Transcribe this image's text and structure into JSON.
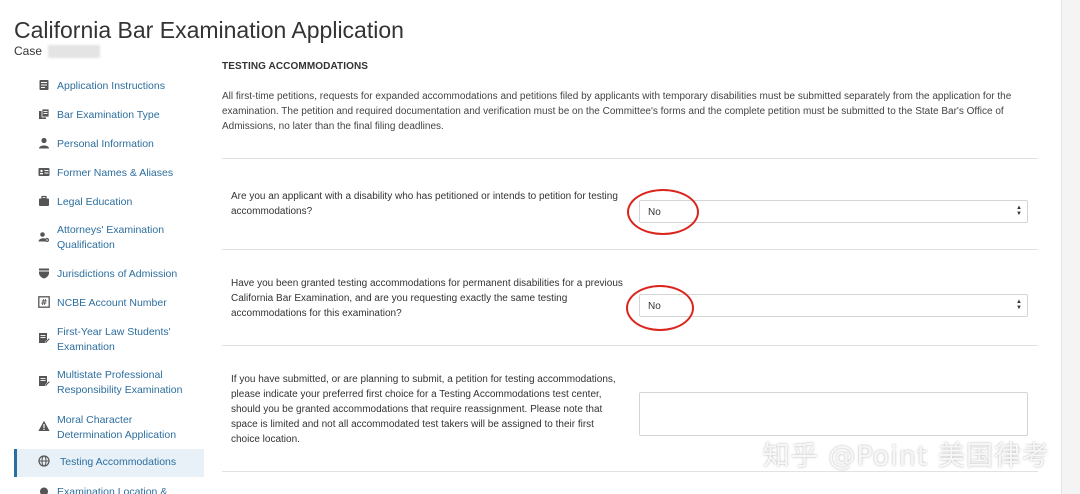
{
  "header": {
    "title": "California Bar Examination Application",
    "case_label": "Case"
  },
  "sidebar": {
    "items": [
      {
        "label": "Application Instructions",
        "icon": "list-doc-icon"
      },
      {
        "label": "Bar Examination Type",
        "icon": "copy-doc-icon"
      },
      {
        "label": "Personal Information",
        "icon": "person-icon"
      },
      {
        "label": "Former Names & Aliases",
        "icon": "id-card-icon"
      },
      {
        "label": "Legal Education",
        "icon": "briefcase-icon"
      },
      {
        "label": "Attorneys' Examination Qualification",
        "icon": "person-gear-icon"
      },
      {
        "label": "Jurisdictions of Admission",
        "icon": "shield-icon"
      },
      {
        "label": "NCBE Account Number",
        "icon": "hash-box-icon"
      },
      {
        "label": "First-Year Law Students' Examination",
        "icon": "edit-doc-icon"
      },
      {
        "label": "Multistate Professional Responsibility Examination",
        "icon": "edit-doc-icon"
      },
      {
        "label": "Moral Character Determination Application",
        "icon": "warning-icon"
      },
      {
        "label": "Testing Accommodations",
        "icon": "globe-icon"
      },
      {
        "label": "Examination Location &",
        "icon": "location-icon"
      }
    ],
    "active_index": 11
  },
  "main": {
    "section_title": "TESTING ACCOMMODATIONS",
    "intro": "All first-time petitions, requests for expanded accommodations and petitions filed by applicants with temporary disabilities must be submitted separately from the application for the examination. The petition and required documentation and verification must be on the Committee's forms and the complete petition must be submitted to the State Bar's Office of Admissions, no later than the final filing deadlines.",
    "questions": [
      {
        "text": "Are you an applicant with a disability who has petitioned or intends to petition for testing accommodations?",
        "value": "No"
      },
      {
        "text": "Have you been granted testing accommodations for permanent disabilities for a previous California Bar Examination, and are you requesting exactly the same testing accommodations for this examination?",
        "value": "No"
      },
      {
        "text": "If you have submitted, or are planning to submit, a petition for testing accommodations, please indicate your preferred first choice for a Testing Accommodations test center, should you be granted accommodations that require reassignment. Please note that space is limited and not all accommodated test takers will be assigned to their first choice location.",
        "value": ""
      }
    ]
  },
  "watermark": "知乎 @Point 美国律考",
  "colors": {
    "link": "#2c6e9e",
    "active_bg": "#e8f1f8",
    "annotation": "#d9251c"
  }
}
